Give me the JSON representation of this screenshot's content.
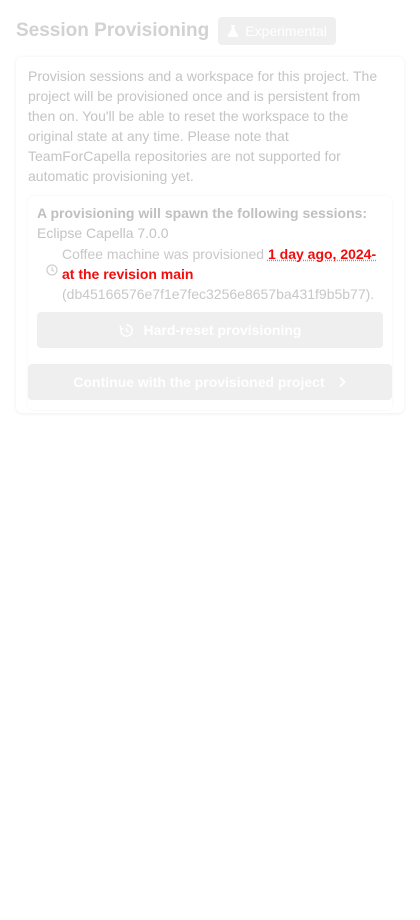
{
  "header": {
    "title": "Session Provisioning",
    "badge_label": "Experimental",
    "badge_icon": "flask-icon"
  },
  "intro_text": "Provision sessions and a workspace for this project. The project will be provisioned once and is persistent from then on. You'll be able to reset the workspace to the original state at any time. Please note that TeamForCapella repositories are not supported for automatic provisioning yet.",
  "provisioning": {
    "spawn_title": "A provisioning will spawn the following sessions:",
    "tool_version": "Eclipse Capella 7.0.0",
    "status_prefix": "Coffee machine was provisioned ",
    "status_date": "1 day ago, 2024-",
    "status_overlay": "at the revision main",
    "commit_hash": "(db45166576e7f1e7fec3256e8657ba431f9b5b77).",
    "clock_icon": "clock-icon"
  },
  "buttons": {
    "reset_label": "Hard-reset provisioning",
    "reset_icon": "history-icon",
    "continue_label": "Continue with the provisioned project",
    "continue_icon": "chevron-right-icon"
  },
  "colors": {
    "highlight": "#f20d0d",
    "disabled_button": "#efefef",
    "muted_text": "#c4c4c4"
  }
}
